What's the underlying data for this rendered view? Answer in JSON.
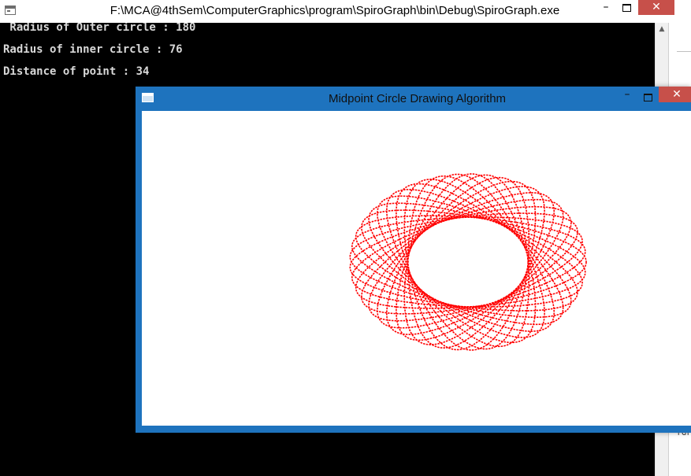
{
  "console": {
    "title": "F:\\MCA@4thSem\\ComputerGraphics\\program\\SpiroGraph\\bin\\Debug\\SpiroGraph.exe",
    "lines": [
      " Radius of Outer circle : 180",
      "Radius of inner circle : 76",
      "Distance of point : 34"
    ],
    "background_fragment": "rGr"
  },
  "graphics_window": {
    "title": "Midpoint Circle Drawing Algorithm"
  },
  "controls": {
    "minimize_glyph": "–",
    "close_glyph": "✕",
    "scroll_up_glyph": "▲"
  },
  "spirograph": {
    "outer_radius": 180,
    "inner_radius": 76,
    "pen_distance": 34,
    "color": "#ff0000"
  },
  "colors": {
    "console_bg": "#000000",
    "console_text": "#d8d8d8",
    "window_frame": "#1e73be",
    "close_button": "#c7504a"
  }
}
